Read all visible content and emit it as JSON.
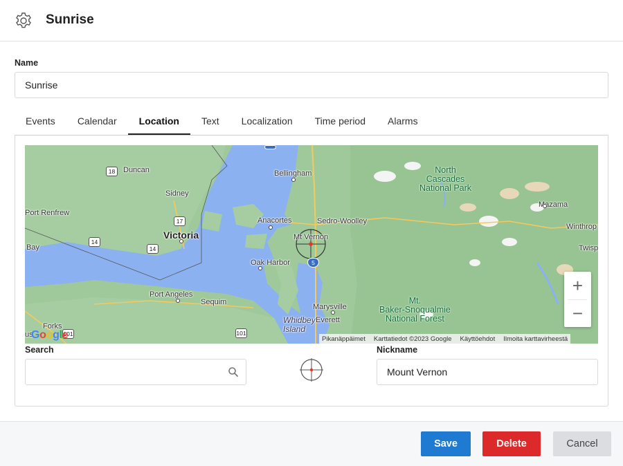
{
  "header": {
    "title": "Sunrise",
    "icon": "gear-icon"
  },
  "form": {
    "name_label": "Name",
    "name_value": "Sunrise"
  },
  "tabs": [
    {
      "label": "Events",
      "active": false
    },
    {
      "label": "Calendar",
      "active": false
    },
    {
      "label": "Location",
      "active": true
    },
    {
      "label": "Text",
      "active": false
    },
    {
      "label": "Localization",
      "active": false
    },
    {
      "label": "Time period",
      "active": false
    },
    {
      "label": "Alarms",
      "active": false
    }
  ],
  "map": {
    "labels": {
      "duncan": "Duncan",
      "sidney": "Sidney",
      "port_renfrew": "Port Renfrew",
      "victoria": "Victoria",
      "bay": "Bay",
      "bellingham": "Bellingham",
      "north_cascades": "North\nCascades\nNational Park",
      "mazama": "Mazama",
      "winthrop": "Winthrop",
      "twisp": "Twisp",
      "anacortes": "Anacortes",
      "sedro_woolley": "Sedro-Woolley",
      "mt_vernon": "Mt Vernon",
      "oak_harbor": "Oak Harbor",
      "port_angeles": "Port Angeles",
      "sequim": "Sequim",
      "marysville": "Marysville",
      "baker": "Mt.\nBaker-Snoqualmie\nNational Forest",
      "whidbey": "Whidbey\nIsland",
      "everett": "Everett",
      "forks": "Forks",
      "us": "us"
    },
    "highways": {
      "h18": "18",
      "h17": "17",
      "h14a": "14",
      "h14b": "14",
      "h5": "5",
      "h101a": "101",
      "h101b": "101",
      "h5top": "5"
    },
    "google": "Google",
    "attribution": {
      "shortcuts": "Pikanäppäimet",
      "data": "Karttatiedot ©2023 Google",
      "terms": "Käyttöehdot",
      "report": "Ilmoita karttavirheestä"
    },
    "zoom_in": "+",
    "zoom_out": "−"
  },
  "location": {
    "search_label": "Search",
    "search_value": "",
    "nickname_label": "Nickname",
    "nickname_value": "Mount Vernon"
  },
  "footer": {
    "save": "Save",
    "delete": "Delete",
    "cancel": "Cancel"
  },
  "colors": {
    "save": "#1f7ad1",
    "delete": "#dc2a2a",
    "cancel": "#dcdde0",
    "water": "#8bb1f0",
    "land": "#a3c7a0"
  }
}
